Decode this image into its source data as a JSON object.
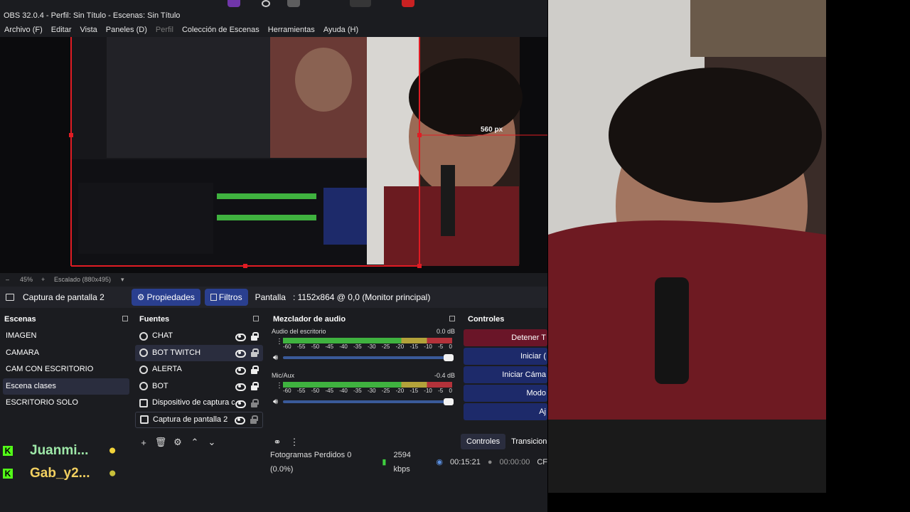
{
  "window": {
    "title": "OBS 32.0.4 - Perfil: Sin Título - Escenas: Sin Título"
  },
  "menu": [
    "Archivo (F)",
    "Editar",
    "Vista",
    "Paneles (D)",
    "Perfil",
    "Colección de Escenas",
    "Herramientas",
    "Ayuda (H)"
  ],
  "preview": {
    "overlay_label": "560 px",
    "zoom": "45%",
    "scaled": "Escalado (880x495)"
  },
  "propbar": {
    "source_name": "Captura de pantalla 2",
    "properties": "Propiedades",
    "filters": "Filtros",
    "screen_label": "Pantalla",
    "screen_value": ": 1152x864 @ 0,0 (Monitor principal)"
  },
  "scenes": {
    "title": "Escenas",
    "items": [
      "IMAGEN",
      "CAMARA",
      "CAM CON ESCRITORIO",
      "Escena clases",
      "ESCRITORIO SOLO"
    ],
    "selected": "Escena clases"
  },
  "sources": {
    "title": "Fuentes",
    "items": [
      {
        "name": "CHAT",
        "icon": "globe-icon",
        "locked": true
      },
      {
        "name": "BOT TWITCH",
        "icon": "globe-icon",
        "locked": false
      },
      {
        "name": "ALERTA",
        "icon": "globe-icon",
        "locked": true
      },
      {
        "name": "BOT",
        "icon": "globe-icon",
        "locked": true
      },
      {
        "name": "Dispositivo de captura c",
        "icon": "camera-icon",
        "locked": false
      },
      {
        "name": "Captura de pantalla 2",
        "icon": "monitor-icon",
        "locked": false
      }
    ]
  },
  "mixer": {
    "title": "Mezclador de audio",
    "channels": [
      {
        "name": "Audio del escritorio",
        "db": "0.0 dB",
        "level": 0.92
      },
      {
        "name": "Mic/Aux",
        "db": "-0.4 dB",
        "level": 0.95
      }
    ],
    "ticks": [
      "-60",
      "-55",
      "-50",
      "-45",
      "-40",
      "-35",
      "-30",
      "-25",
      "-20",
      "-15",
      "-10",
      "-5",
      "0"
    ]
  },
  "controls": {
    "title": "Controles",
    "buttons": [
      "Detener T",
      "Iniciar (",
      "Iniciar Cáma",
      "Modo",
      "Aj"
    ],
    "tabs": [
      "Controles",
      "Transicion"
    ]
  },
  "status": {
    "dropped": "Fotogramas Perdidos 0 (0.0%)",
    "bitrate": "2594 kbps",
    "stream_time": "00:15:21",
    "rec_time": "00:00:00",
    "cpu": "CF"
  },
  "chat": [
    {
      "user": "Juanmi..."
    },
    {
      "user": "Gab_y2..."
    }
  ],
  "colors": {
    "accent": "#2a3f8f",
    "stop": "#6a1528",
    "bg": "#1b1c20",
    "kick": "#53fc18"
  }
}
